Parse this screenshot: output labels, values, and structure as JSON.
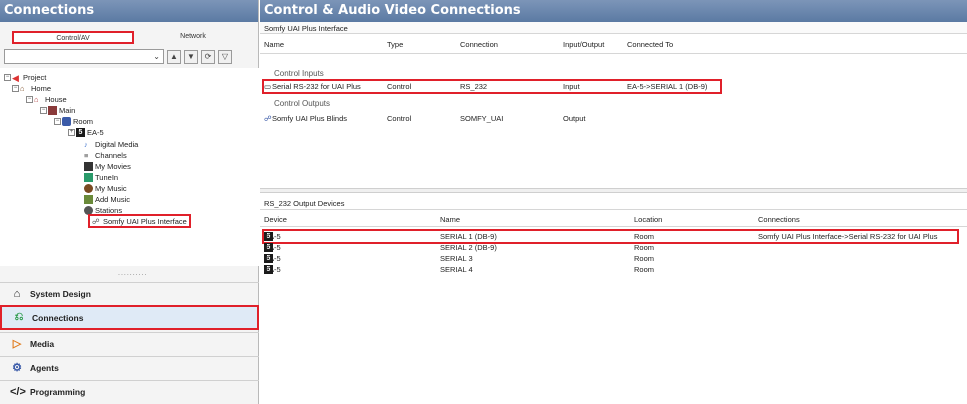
{
  "left": {
    "title": "Connections",
    "tabs": [
      "Control/AV",
      "Network"
    ],
    "tree": {
      "project": "Project",
      "home": "Home",
      "house": "House",
      "main": "Main",
      "room": "Room",
      "ea5": "EA-5",
      "digital_media": "Digital Media",
      "channels": "Channels",
      "my_movies": "My Movies",
      "tunein": "TuneIn",
      "my_music": "My Music",
      "add_music": "Add Music",
      "stations": "Stations",
      "somfy": "Somfy UAI Plus Interface"
    },
    "grip": "..........",
    "nav": [
      "System Design",
      "Connections",
      "Media",
      "Agents",
      "Programming"
    ]
  },
  "right": {
    "title": "Control & Audio Video Connections",
    "subtitle": "Somfy UAI Plus Interface",
    "columns": [
      "Name",
      "Type",
      "Connection",
      "Input/Output",
      "Connected To"
    ],
    "group_inputs": "Control Inputs",
    "group_outputs": "Control Outputs",
    "rows": [
      {
        "name": "Serial RS-232 for UAI Plus",
        "type": "Control",
        "connection": "RS_232",
        "io": "Input",
        "connected": "EA-5->SERIAL 1 (DB-9)"
      },
      {
        "name": "Somfy UAI Plus Blinds",
        "type": "Control",
        "connection": "SOMFY_UAI",
        "io": "Output",
        "connected": ""
      }
    ],
    "devices_title": "RS_232 Output Devices",
    "device_columns": [
      "Device",
      "Name",
      "Location",
      "Connections"
    ],
    "devices": [
      {
        "device": "EA-5",
        "name": "SERIAL 1 (DB-9)",
        "location": "Room",
        "connections": "Somfy UAI Plus Interface->Serial RS-232 for UAI Plus"
      },
      {
        "device": "EA-5",
        "name": "SERIAL 2 (DB-9)",
        "location": "Room",
        "connections": ""
      },
      {
        "device": "EA-5",
        "name": "SERIAL 3",
        "location": "Room",
        "connections": ""
      },
      {
        "device": "EA-5",
        "name": "SERIAL 4",
        "location": "Room",
        "connections": ""
      }
    ]
  },
  "colors": {
    "highlight": "#e0202a",
    "header": "#5b7aa3",
    "active_nav": "#dfeaf6"
  }
}
